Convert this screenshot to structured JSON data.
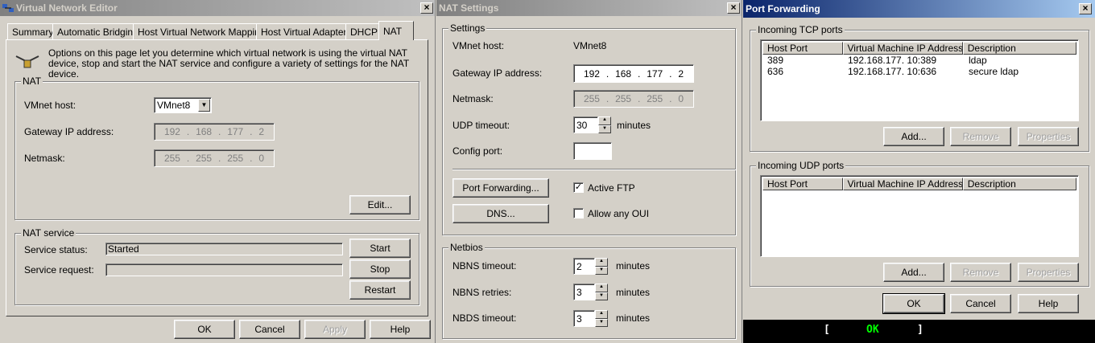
{
  "vne": {
    "title": "Virtual Network Editor",
    "tabs": [
      "Summary",
      "Automatic Bridging",
      "Host Virtual Network Mapping",
      "Host Virtual Adapters",
      "DHCP",
      "NAT"
    ],
    "intro": "Options on this page let you determine which virtual network is using the virtual NAT device, stop and start the NAT service and configure a variety of settings for the NAT device.",
    "nat_group": "NAT",
    "vmnet_label": "VMnet host:",
    "vmnet_value": "VMnet8",
    "gateway_label": "Gateway IP address:",
    "gateway_ip": [
      "192",
      "168",
      "177",
      "2"
    ],
    "netmask_label": "Netmask:",
    "netmask": [
      "255",
      "255",
      "255",
      "0"
    ],
    "edit": "Edit...",
    "service_group": "NAT service",
    "status_label": "Service status:",
    "status_value": "Started",
    "request_label": "Service request:",
    "start": "Start",
    "stop": "Stop",
    "restart": "Restart",
    "ok": "OK",
    "cancel": "Cancel",
    "apply": "Apply",
    "help": "Help"
  },
  "nat": {
    "title": "NAT Settings",
    "settings_group": "Settings",
    "vmnet_label": "VMnet host:",
    "vmnet_value": "VMnet8",
    "gateway_label": "Gateway IP address:",
    "gateway_ip": [
      "192",
      "168",
      "177",
      "2"
    ],
    "netmask_label": "Netmask:",
    "netmask": [
      "255",
      "255",
      "255",
      "0"
    ],
    "udp_label": "UDP timeout:",
    "udp_value": "30",
    "minutes": "minutes",
    "config_label": "Config port:",
    "port_forwarding": "Port Forwarding...",
    "dns": "DNS...",
    "active_ftp": "Active FTP",
    "active_ftp_check": "✓",
    "allow_oui": "Allow any OUI",
    "netbios_group": "Netbios",
    "nbns_timeout_label": "NBNS timeout:",
    "nbns_timeout": "2",
    "nbns_retries_label": "NBNS retries:",
    "nbns_retries": "3",
    "nbds_timeout_label": "NBDS timeout:",
    "nbds_timeout": "3"
  },
  "pf": {
    "title": "Port Forwarding",
    "tcp_group": "Incoming TCP ports",
    "udp_group": "Incoming UDP ports",
    "columns": [
      "Host Port",
      "Virtual Machine IP Address",
      "Description"
    ],
    "tcp_rows": [
      {
        "port": "389",
        "ip": "192.168.177. 10:389",
        "desc": "ldap"
      },
      {
        "port": "636",
        "ip": "192.168.177. 10:636",
        "desc": "secure ldap"
      }
    ],
    "add": "Add...",
    "remove": "Remove",
    "properties": "Properties",
    "ok": "OK",
    "cancel": "Cancel",
    "help": "Help"
  },
  "console": {
    "open": "[",
    "ok": "OK",
    "close": "]"
  },
  "colors": {
    "active_title": "#0a246a",
    "inactive_title": "#808080",
    "console_ok": "#00ff00"
  }
}
